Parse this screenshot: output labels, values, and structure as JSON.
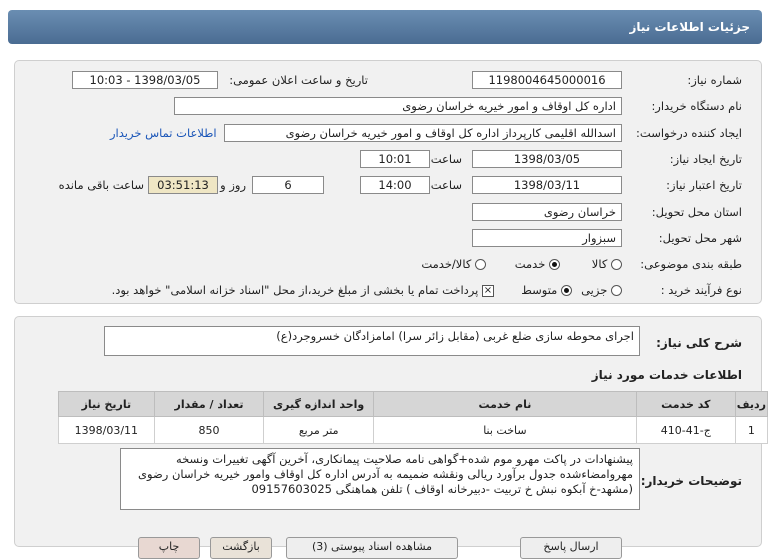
{
  "title": "جزئیات اطلاعات نیاز",
  "form": {
    "need_number_label": "شماره نیاز:",
    "need_number": "1198004645000016",
    "announce_label": "تاریخ و ساعت اعلان عمومی:",
    "announce_value": "1398/03/05 - 10:03",
    "buyer_label": "نام دستگاه خریدار:",
    "buyer_value": "اداره کل اوقاف و امور خیریه خراسان رضوی",
    "creator_label": "ایجاد کننده درخواست:",
    "creator_value": "اسدالله اقلیمی کارپرداز اداره کل اوقاف و امور خیریه خراسان رضوی",
    "contact_link": "اطلاعات تماس خریدار",
    "created_date_label": "تاریخ ایجاد نیاز:",
    "created_date": "1398/03/05",
    "hour_label": "ساعت",
    "created_time": "10:01",
    "validity_label": "تاریخ اعتبار نیاز:",
    "validity_date": "1398/03/11",
    "validity_time": "14:00",
    "days_value": "6",
    "days_label": "روز و",
    "remaining_time": "03:51:13",
    "remaining_label": "ساعت باقی مانده",
    "province_label": "استان محل تحویل:",
    "province_value": "خراسان رضوی",
    "city_label": "شهر محل تحویل:",
    "city_value": "سبزوار",
    "category_label": "طبقه بندی موضوعی:",
    "category_options": [
      "کالا",
      "خدمت",
      "کالا/خدمت"
    ],
    "category_selected": "خدمت",
    "process_label": "نوع فرآیند خرید :",
    "process_options": [
      "جزیی",
      "متوسط"
    ],
    "process_selected": "متوسط",
    "payment_note": "پرداخت تمام یا بخشی از مبلغ خرید،از محل \"اسناد خزانه اسلامی\" خواهد بود."
  },
  "summary": {
    "label": "شرح کلی نیاز:",
    "value": "اجرای محوطه سازی ضلع غربی (مقابل زائر سرا) امامزادگان خسروجرد(ع)"
  },
  "services": {
    "section_title": "اطلاعات خدمات مورد نیاز",
    "headers": [
      "ردیف",
      "کد خدمت",
      "نام خدمت",
      "واحد اندازه گیری",
      "تعداد / مقدار",
      "تاریخ نیاز"
    ],
    "rows": [
      [
        "1",
        "ج-41-410",
        "ساخت بنا",
        "متر مربع",
        "850",
        "1398/03/11"
      ]
    ]
  },
  "buyer_notes": {
    "label": "توضیحات خریدار:",
    "text": "پیشنهادات در پاکت مهرو موم شده+گواهی نامه صلاحیت پیمانکاری، آخرین آگهی تغییرات ونسخه مهروامضاءشده جدول برآورد ریالی ونقشه ضمیمه به آدرس اداره کل اوقاف وامور خیریه خراسان رضوی (مشهد-خ آبکوه نبش خ تربیت -دبیرخانه اوقاف ) تلفن هماهنگی 09157603025"
  },
  "footer_buttons": [
    "بازگشت",
    "چاپ",
    "مشاهده اسناد پیوستی (3)",
    "ارسال پاسخ"
  ],
  "colors": {
    "title_bar": "#5b7fa6",
    "link": "#1a55b8",
    "table_header": "#d6d6d6"
  }
}
